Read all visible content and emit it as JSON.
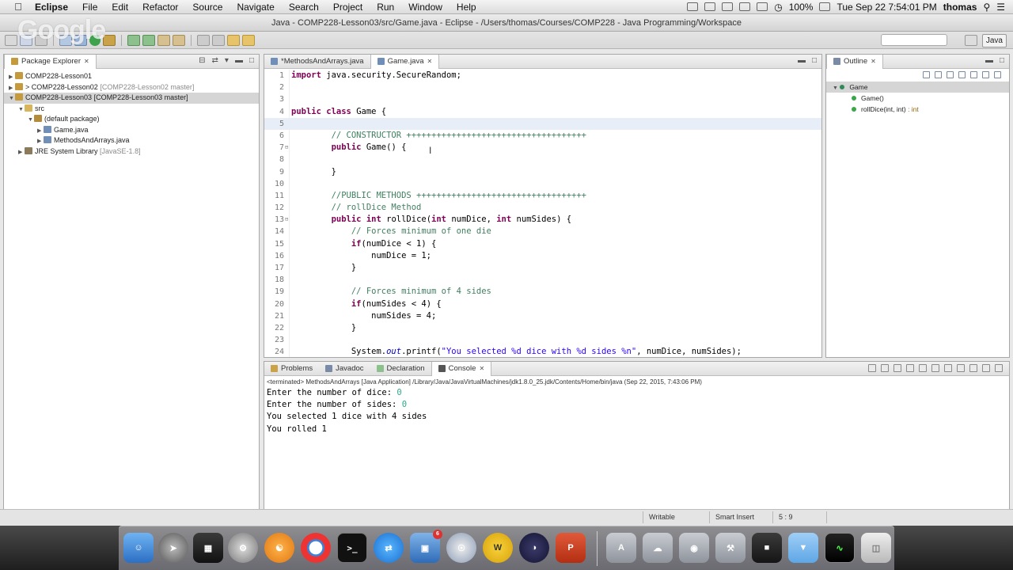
{
  "menubar": {
    "app": "Eclipse",
    "items": [
      "File",
      "Edit",
      "Refactor",
      "Source",
      "Navigate",
      "Search",
      "Project",
      "Run",
      "Window",
      "Help"
    ],
    "battery": "100%",
    "datetime": "Tue Sep 22  7:54:01 PM",
    "user": "thomas"
  },
  "window": {
    "title": "Java - COMP228-Lesson03/src/Game.java - Eclipse - /Users/thomas/Courses/COMP228 - Java Programming/Workspace",
    "watermark": "Google",
    "perspective": "Java"
  },
  "package_explorer": {
    "title": "Package Explorer",
    "items": [
      {
        "label": "COMP228-Lesson01",
        "extra": ""
      },
      {
        "label": "> COMP228-Lesson02",
        "extra": "[COMP228-Lesson02 master]"
      },
      {
        "label": "COMP228-Lesson03",
        "extra": "[COMP228-Lesson03 master]"
      },
      {
        "label": "src",
        "extra": ""
      },
      {
        "label": "(default package)",
        "extra": ""
      },
      {
        "label": "Game.java",
        "extra": ""
      },
      {
        "label": "MethodsAndArrays.java",
        "extra": ""
      },
      {
        "label": "JRE System Library",
        "extra": "[JavaSE-1.8]"
      }
    ]
  },
  "editor": {
    "tabs": [
      {
        "label": "*MethodsAndArrays.java",
        "active": false
      },
      {
        "label": "Game.java",
        "active": true
      }
    ],
    "line_numbers": [
      "1",
      "2",
      "3",
      "4",
      "5",
      "6",
      "7",
      "8",
      "9",
      "10",
      "11",
      "12",
      "13",
      "14",
      "15",
      "16",
      "17",
      "18",
      "19",
      "20",
      "21",
      "22",
      "23",
      "24"
    ],
    "lines": [
      "import java.security.SecureRandom;",
      "",
      "",
      "public class Game {",
      "",
      "        // CONSTRUCTOR ++++++++++++++++++++++++++++++++++++",
      "        public Game() {",
      "",
      "        }",
      "",
      "        //PUBLIC METHODS ++++++++++++++++++++++++++++++++++",
      "        // rollDice Method",
      "        public int rollDice(int numDice, int numSides) {",
      "            // Forces minimum of one die",
      "            if(numDice < 1) {",
      "                numDice = 1;",
      "            }",
      "",
      "            // Forces minimum of 4 sides",
      "            if(numSides < 4) {",
      "                numSides = 4;",
      "            }",
      "",
      "            System.out.printf(\"You selected %d dice with %d sides %n\", numDice, numSides);"
    ]
  },
  "outline": {
    "title": "Outline",
    "items": [
      {
        "label": "Game",
        "ret": ""
      },
      {
        "label": "Game()",
        "ret": ""
      },
      {
        "label": "rollDice(int, int)",
        "ret": ": int"
      }
    ]
  },
  "bottom_panel": {
    "tabs": [
      "Problems",
      "Javadoc",
      "Declaration",
      "Console"
    ],
    "active_tab": "Console",
    "info": "<terminated> MethodsAndArrays [Java Application] /Library/Java/JavaVirtualMachines/jdk1.8.0_25.jdk/Contents/Home/bin/java (Sep 22, 2015, 7:43:06 PM)",
    "output": [
      {
        "text": "Enter the number of dice: ",
        "input": "0"
      },
      {
        "text": "Enter the number of sides: ",
        "input": "0"
      },
      {
        "text": "You selected 1 dice with 4 sides",
        "input": ""
      },
      {
        "text": "You rolled 1",
        "input": ""
      }
    ]
  },
  "status": {
    "writable": "Writable",
    "insert_mode": "Smart Insert",
    "position": "5 : 9"
  },
  "dock": {
    "badge": "6"
  }
}
